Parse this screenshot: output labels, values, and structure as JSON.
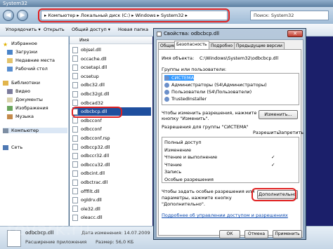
{
  "window": {
    "title": "System32"
  },
  "address": {
    "path": "▸ Компьютер ▸ Локальный диск (C:) ▸ Windows ▸ System32 ▸",
    "search_placeholder": "Поиск: System32"
  },
  "toolbar": {
    "organize": "Упорядочить ▾",
    "open": "Открыть",
    "open_with": "Общий доступ ▾",
    "burn": "Новая папка"
  },
  "nav": {
    "favorites": "Избранное",
    "downloads": "Загрузки",
    "recent": "Недавние места",
    "desktop": "Рабочий стол",
    "libraries": "Библиотеки",
    "video": "Видео",
    "documents": "Документы",
    "pictures": "Изображения",
    "music": "Музыка",
    "computer": "Компьютер",
    "network": "Сеть"
  },
  "filelist": {
    "header": "Имя",
    "files": [
      "objsel.dll",
      "occache.dll",
      "ocsetapi.dll",
      "ocsetup",
      "odbc32.dll",
      "odbc32gt.dll",
      "odbcad32",
      "odbcbcp.dll",
      "odbcconf",
      "odbcconf",
      "odbcconf.rsp",
      "odbccp32.dll",
      "odbccr32.dll",
      "odbccu32.dll",
      "odbcint.dll",
      "odbctrac.dll",
      "offfilt.dll",
      "ogldrv.dll",
      "ole32.dll",
      "oleacc.dll"
    ]
  },
  "status": {
    "name": "odbcbcp.dll",
    "modified_label": "Дата изменения: 14.07.2009",
    "type": "Расширение приложения",
    "size": "Размер: 56,0 КБ"
  },
  "dialog": {
    "title": "Свойства: odbcbcp.dll",
    "close": "✕",
    "tabs": [
      "Общие",
      "Безопасность",
      "Подробно",
      "Предыдущие версии"
    ],
    "object_label": "Имя объекта:",
    "object_value": "C:\\Windows\\System32\\odbcbcp.dll",
    "groups_label": "Группы или пользователи:",
    "groups": [
      "СИСТЕМА",
      "Администраторы (S4\\Администраторы)",
      "Пользователи (S4\\Пользователи)",
      "TrustedInstaller"
    ],
    "change_text": "Чтобы изменить разрешения, нажмите кнопку \"Изменить\".",
    "change_button": "Изменить...",
    "perm_label": "Разрешения для группы \"СИСТЕМА\"",
    "allow": "Разрешить",
    "deny": "Запретить",
    "perms": [
      {
        "name": "Полный доступ",
        "allow": ""
      },
      {
        "name": "Изменение",
        "allow": ""
      },
      {
        "name": "Чтение и выполнение",
        "allow": "✓"
      },
      {
        "name": "Чтение",
        "allow": "✓"
      },
      {
        "name": "Запись",
        "allow": ""
      },
      {
        "name": "Особые разрешения",
        "allow": ""
      }
    ],
    "special_text_1": "Чтобы задать особые разрешения или",
    "special_text_2": "параметры, нажмите кнопку",
    "special_text_3": "\"Дополнительно\".",
    "advanced_button": "Дополнительно",
    "link": "Подробнее об управлении доступом и разрешениях",
    "ok": "ОК",
    "cancel": "Отмена",
    "apply": "Применить"
  },
  "watermark": "tevark.ru"
}
